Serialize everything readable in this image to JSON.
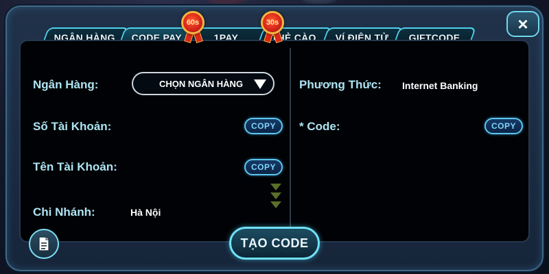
{
  "tabs": [
    {
      "label": "NGÂN HÀNG"
    },
    {
      "label": "CODE PAY"
    },
    {
      "label": "1PAY"
    },
    {
      "label": "THẺ CÀO"
    },
    {
      "label": "VÍ ĐIỆN TỬ"
    },
    {
      "label": "GIFTCODE"
    }
  ],
  "badges": {
    "code_pay": "60s",
    "one_pay": "30s"
  },
  "close_icon": "×",
  "left": {
    "bank_label": "Ngân Hàng:",
    "bank_select": "CHỌN NGÂN HÀNG",
    "account_number_label": "Số Tài Khoản:",
    "account_name_label": "Tên Tài Khoản:",
    "branch_label": "Chi Nhánh:",
    "branch_value": "Hà Nội"
  },
  "right": {
    "method_label": "Phương Thức:",
    "method_value": "Internet Banking",
    "code_label": "* Code:"
  },
  "copy_label": "COPY",
  "create_button": "TẠO CODE",
  "colors": {
    "accent": "#4fd3ec",
    "label": "#aee4f3",
    "badge": "#d8261a"
  }
}
